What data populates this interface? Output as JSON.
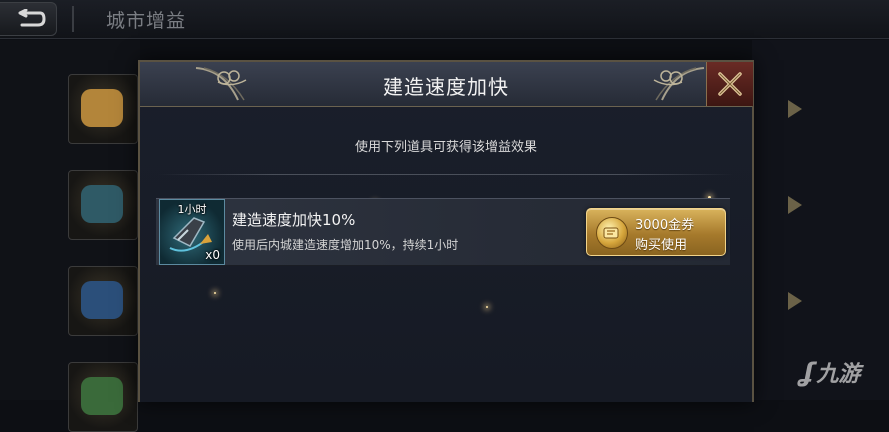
{
  "screen": {
    "title": "城市增益",
    "back_icon": "back-arrow-icon"
  },
  "dialog": {
    "title": "建造速度加快",
    "subtitle": "使用下列道具可获得该增益效果",
    "close_icon": "close-icon"
  },
  "items": [
    {
      "duration": "1小时",
      "count": "x0",
      "name": "建造速度加快10%",
      "description": "使用后内城建造速度增加10%，持续1小时",
      "price": "3000金券",
      "buy_label": "购买使用",
      "currency_icon": "gold-coupon-icon"
    }
  ],
  "watermark": {
    "text": "九游"
  },
  "colors": {
    "accent_gold": "#d9b35c",
    "close_red": "#6a2b25",
    "panel_bg": "#1a1f2b"
  }
}
